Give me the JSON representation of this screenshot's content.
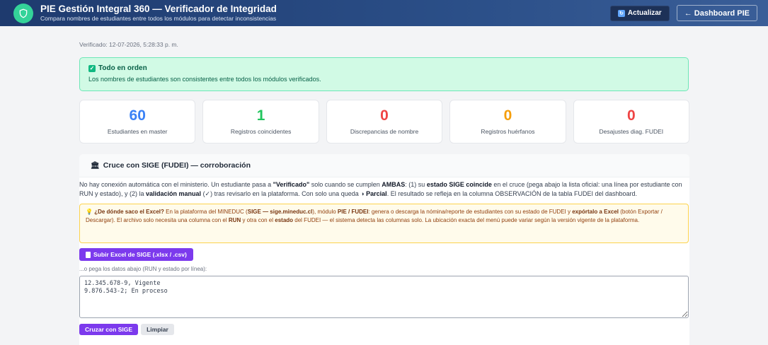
{
  "header": {
    "title": "PIE Gestión Integral 360 — Verificador de Integridad",
    "subtitle": "Compara nombres de estudiantes entre todos los módulos para detectar inconsistencias",
    "refresh_label": "Actualizar",
    "dashboard_label": "← Dashboard PIE"
  },
  "verified_at": "Verificado: 12-07-2026, 5:28:33 p. m.",
  "status": {
    "title": "Todo en orden",
    "text": "Los nombres de estudiantes son consistentes entre todos los módulos verificados."
  },
  "stats": [
    {
      "value": "60",
      "label": "Estudiantes en master",
      "color": "#3b82f6"
    },
    {
      "value": "1",
      "label": "Registros coincidentes",
      "color": "#22c55e"
    },
    {
      "value": "0",
      "label": "Discrepancias de nombre",
      "color": "#ef4444"
    },
    {
      "value": "0",
      "label": "Registros huérfanos",
      "color": "#f59e0b"
    },
    {
      "value": "0",
      "label": "Desajustes diag. FUDEI",
      "color": "#ef4444"
    }
  ],
  "sige": {
    "title": "Cruce con SIGE (FUDEI) — corroboración",
    "desc": {
      "p1": "No hay conexión automática con el ministerio. Un estudiante pasa a ",
      "b1": "\"Verificado\"",
      "p2": " solo cuando se cumplen ",
      "b2": "AMBAS",
      "p3": ": (1) su ",
      "b3": "estado SIGE coincide",
      "p4": " en el cruce (pega abajo la lista oficial: una línea por estudiante con RUN y estado), y (2) la ",
      "b4": "validación manual",
      "p5": " (✓) tras revisarlo en la plataforma. Con solo una queda ◑ ",
      "b5": "Parcial",
      "p6": ". El resultado se refleja en la columna OBSERVACIÓN de la tabla FUDEI del dashboard."
    },
    "hint": {
      "b1": "¿De dónde saco el Excel?",
      "p1": " En la plataforma del MINEDUC (",
      "b2": "SIGE — sige.mineduc.cl",
      "p2": "), módulo ",
      "b3": "PIE / FUDEI",
      "p3": ": genera o descarga la nómina/reporte de estudiantes con su estado de FUDEI y ",
      "b4": "expórtalo a Excel",
      "p4": " (botón Exportar / Descargar). El archivo solo necesita una columna con el ",
      "b5": "RUN",
      "p5": " y otra con el ",
      "b6": "estado",
      "p6": " del FUDEI — el sistema detecta las columnas solo. La ubicación exacta del menú puede variar según la versión vigente de la plataforma."
    },
    "upload_label": "Subir Excel de SIGE (.xlsx / .csv)",
    "paste_label": "...o pega los datos abajo (RUN y estado por línea):",
    "paste_value": "12.345.678-9, Vigente\n9.876.543-2; En proceso",
    "cross_label": "Cruzar con SIGE",
    "clear_label": "Limpiar"
  }
}
